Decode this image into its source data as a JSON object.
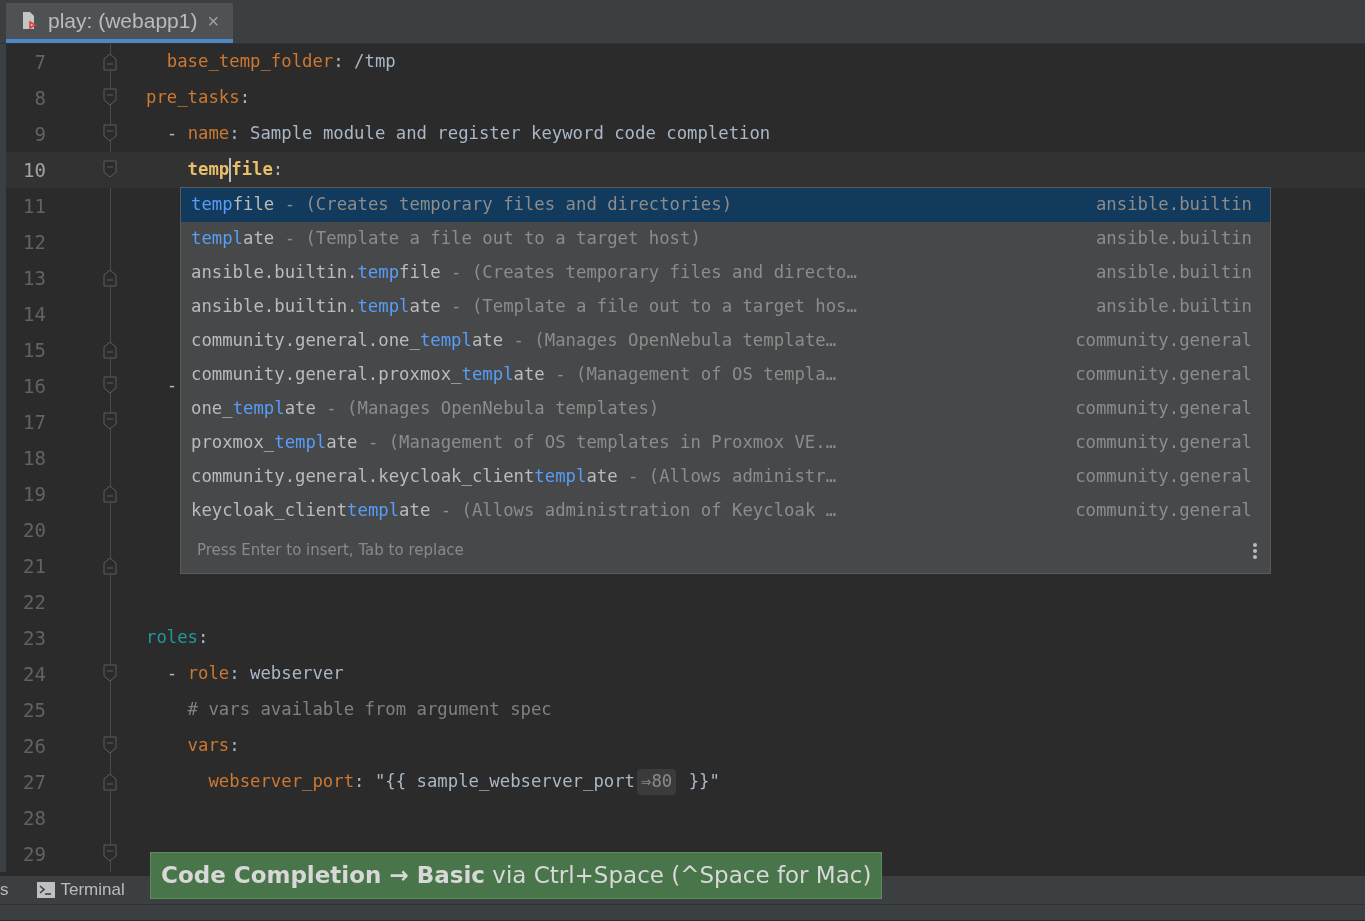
{
  "tab": {
    "title": "play: (webapp1)",
    "close": "×",
    "selected": true
  },
  "lines": [
    {
      "number": "7",
      "fold_start": false,
      "fold_end": true,
      "current": false,
      "tokens": [
        {
          "kind": "key",
          "text": "  base_temp_folder"
        },
        {
          "kind": "punct",
          "text": ": "
        },
        {
          "kind": "value",
          "text": "/tmp"
        }
      ]
    },
    {
      "number": "8",
      "fold_start": true,
      "fold_end": false,
      "current": false,
      "tokens": [
        {
          "kind": "key",
          "text": "pre_tasks"
        },
        {
          "kind": "punct",
          "text": ":"
        }
      ]
    },
    {
      "number": "9",
      "fold_start": true,
      "fold_end": false,
      "current": false,
      "tokens": [
        {
          "kind": "punct",
          "text": "  - "
        },
        {
          "kind": "key",
          "text": "name"
        },
        {
          "kind": "punct",
          "text": ": "
        },
        {
          "kind": "value",
          "text": "Sample module and register keyword code completion"
        }
      ]
    },
    {
      "number": "10",
      "fold_start": true,
      "fold_end": false,
      "current": true,
      "tokens": [
        {
          "kind": "strong",
          "text": "    temp"
        },
        {
          "kind": "caret"
        },
        {
          "kind": "strong",
          "text": "file"
        },
        {
          "kind": "punct",
          "text": ":"
        }
      ]
    },
    {
      "number": "11",
      "fold_start": false,
      "fold_end": false,
      "current": false
    },
    {
      "number": "12",
      "fold_start": false,
      "fold_end": false,
      "current": false
    },
    {
      "number": "13",
      "fold_start": false,
      "fold_end": true,
      "current": false
    },
    {
      "number": "14",
      "fold_start": false,
      "fold_end": false,
      "current": false
    },
    {
      "number": "15",
      "fold_start": false,
      "fold_end": true,
      "current": false
    },
    {
      "number": "16",
      "fold_start": true,
      "fold_end": false,
      "current": false,
      "tokens": [
        {
          "kind": "punct",
          "text": "  -"
        }
      ]
    },
    {
      "number": "17",
      "fold_start": true,
      "fold_end": false,
      "current": false
    },
    {
      "number": "18",
      "fold_start": false,
      "fold_end": false,
      "current": false
    },
    {
      "number": "19",
      "fold_start": false,
      "fold_end": true,
      "current": false
    },
    {
      "number": "20",
      "fold_start": false,
      "fold_end": false,
      "current": false
    },
    {
      "number": "21",
      "fold_start": false,
      "fold_end": true,
      "current": false
    },
    {
      "number": "22",
      "fold_start": false,
      "fold_end": false,
      "current": false
    },
    {
      "number": "23",
      "fold_start": false,
      "fold_end": false,
      "current": false,
      "tokens": [
        {
          "kind": "section",
          "text": "roles"
        },
        {
          "kind": "punct",
          "text": ":"
        }
      ]
    },
    {
      "number": "24",
      "fold_start": true,
      "fold_end": false,
      "current": false,
      "tokens": [
        {
          "kind": "punct",
          "text": "  - "
        },
        {
          "kind": "key",
          "text": "role"
        },
        {
          "kind": "punct",
          "text": ": "
        },
        {
          "kind": "value",
          "text": "webserver"
        }
      ]
    },
    {
      "number": "25",
      "fold_start": false,
      "fold_end": false,
      "current": false,
      "tokens": [
        {
          "kind": "comment",
          "text": "    # vars available from argument spec"
        }
      ]
    },
    {
      "number": "26",
      "fold_start": true,
      "fold_end": false,
      "current": false,
      "tokens": [
        {
          "kind": "key",
          "text": "    vars"
        },
        {
          "kind": "punct",
          "text": ":"
        }
      ]
    },
    {
      "number": "27",
      "fold_start": false,
      "fold_end": true,
      "current": false,
      "tokens": [
        {
          "kind": "key",
          "text": "      webserver_port"
        },
        {
          "kind": "punct",
          "text": ": "
        },
        {
          "kind": "value",
          "text": "\"{{ sample_webserver_port"
        },
        {
          "kind": "hint",
          "text": "⇒80"
        },
        {
          "kind": "value",
          "text": " }}\""
        }
      ]
    },
    {
      "number": "28",
      "fold_start": false,
      "fold_end": false,
      "current": false
    },
    {
      "number": "29",
      "fold_start": true,
      "fold_end": false,
      "current": false
    }
  ],
  "completion": {
    "items": [
      {
        "selected": true,
        "match": "temp",
        "suffix": "file",
        "description": " - (Creates temporary files and directories)",
        "source": "ansible.builtin"
      },
      {
        "selected": false,
        "match": "templ",
        "suffix": "ate",
        "description": " - (Template a file out to a target host)",
        "source": "ansible.builtin"
      },
      {
        "selected": false,
        "prefix": "ansible.builtin.",
        "match": "temp",
        "suffix": "file",
        "description": " - (Creates temporary files and directo…",
        "source": "ansible.builtin"
      },
      {
        "selected": false,
        "prefix": "ansible.builtin.",
        "match": "templ",
        "suffix": "ate",
        "description": " - (Template a file out to a target hos…",
        "source": "ansible.builtin"
      },
      {
        "selected": false,
        "prefix": "community.general.one_",
        "match": "templ",
        "suffix": "ate",
        "description": " - (Manages OpenNebula template…",
        "source": "community.general"
      },
      {
        "selected": false,
        "prefix": "community.general.proxmox_",
        "match": "templ",
        "suffix": "ate",
        "description": " - (Management of OS templa…",
        "source": "community.general"
      },
      {
        "selected": false,
        "prefix": "one_",
        "match": "templ",
        "suffix": "ate",
        "description": " - (Manages OpenNebula templates)",
        "source": "community.general"
      },
      {
        "selected": false,
        "prefix": "proxmox_",
        "match": "templ",
        "suffix": "ate",
        "description": " - (Management of OS templates in Proxmox VE.…",
        "source": "community.general"
      },
      {
        "selected": false,
        "prefix": "community.general.keycloak_client",
        "match": "templ",
        "suffix": "ate",
        "description": " - (Allows administr…",
        "source": "community.general"
      },
      {
        "selected": false,
        "prefix": "keycloak_client",
        "match": "templ",
        "suffix": "ate",
        "description": " - (Allows administration of Keycloak …",
        "source": "community.general"
      }
    ],
    "footer": "Press Enter to insert, Tab to replace"
  },
  "tool_window_bar": {
    "cut_label": "s",
    "terminal": "Terminal"
  },
  "tip": "**Code Completion → Basic** via Ctrl+Space (^Space for Mac)"
}
